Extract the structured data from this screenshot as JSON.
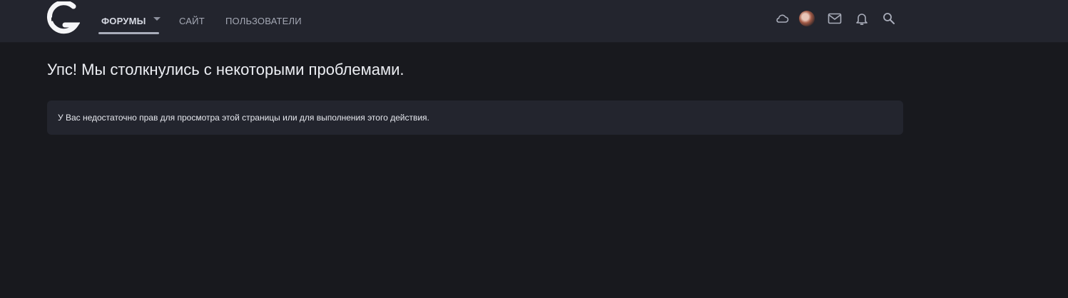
{
  "header": {
    "logo_icon": "site-logo-g",
    "nav": {
      "tabs": [
        {
          "label": "ФОРУМЫ",
          "active": true
        },
        {
          "label": "САЙТ",
          "active": false
        },
        {
          "label": "ПОЛЬЗОВАТЕЛИ",
          "active": false
        }
      ]
    },
    "actions": [
      {
        "icon": "cloud-icon"
      },
      {
        "icon": "avatar"
      },
      {
        "icon": "mail-icon"
      },
      {
        "icon": "bell-icon"
      },
      {
        "icon": "search-icon"
      }
    ]
  },
  "main": {
    "title": "Упс! Мы столкнулись с некоторыми проблемами.",
    "message": "У Вас недостаточно прав для просмотра этой страницы или для выполнения этого действия."
  },
  "colors": {
    "background": "#18191e",
    "header": "#23252e",
    "panel": "#23252e",
    "text": "#e8e9ed"
  }
}
